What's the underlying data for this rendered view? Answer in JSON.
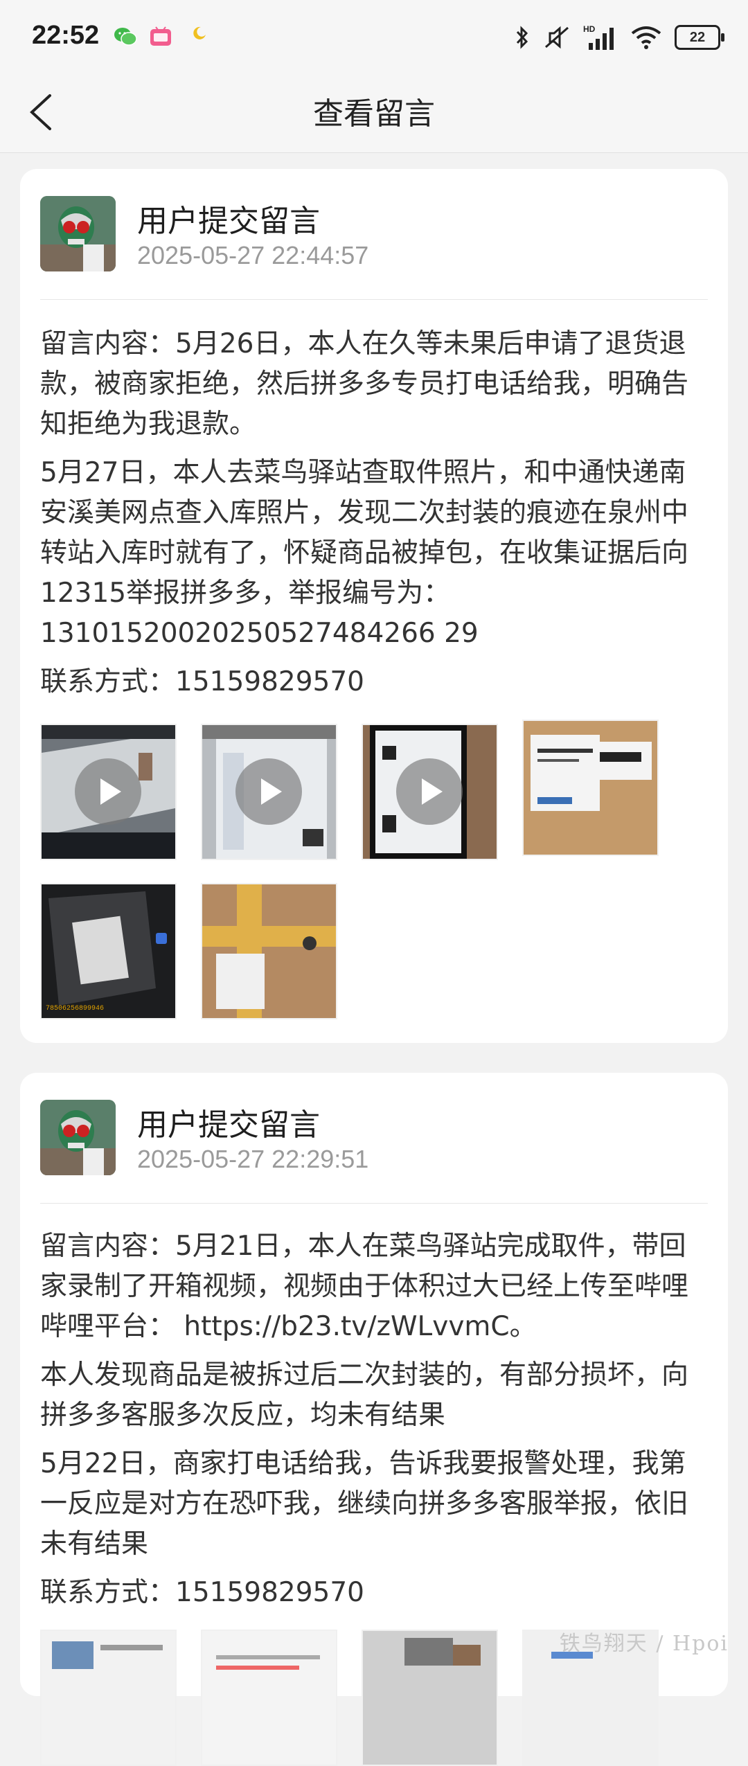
{
  "status_bar": {
    "time": "22:52",
    "battery": "22",
    "icons": [
      "wechat-icon",
      "bilibili-icon",
      "moon-icon",
      "bluetooth-icon",
      "mute-icon",
      "hd-signal-icon",
      "wifi-icon",
      "battery-icon"
    ]
  },
  "header": {
    "title": "查看留言",
    "back_icon": "chevron-left-icon"
  },
  "messages": [
    {
      "title": "用户提交留言",
      "time": "2025-05-27 22:44:57",
      "p1": "留言内容：5月26日，本人在久等未果后申请了退货退款，被商家拒绝，然后拼多多专员打电话给我，明确告知拒绝为我退款。",
      "p2": "5月27日，本人去菜鸟驿站查取件照片，和中通快递南安溪美网点查入库照片，发现二次封装的痕迹在泉州中转站入库时就有了，怀疑商品被掉包，在收集证据后向12315举报拼多多，举报编号为：13101520020250527484266 29",
      "contact": "联系方式：15159829570",
      "thumb_caption": "78506256899946"
    },
    {
      "title": "用户提交留言",
      "time": "2025-05-27 22:29:51",
      "p1": "留言内容：5月21日，本人在菜鸟驿站完成取件，带回家录制了开箱视频，视频由于体积过大已经上传至哔哩哔哩平台： https://b23.tv/zWLvvmC。",
      "p2": "本人发现商品是被拆过后二次封装的，有部分损坏，向拼多多客服多次反应，均未有结果",
      "p3": "5月22日，商家打电话给我，告诉我要报警处理，我第一反应是对方在恐吓我，继续向拼多多客服举报，依旧未有结果",
      "contact": "联系方式：15159829570"
    }
  ],
  "watermark": "铁鸟翔天 / Hpoi"
}
